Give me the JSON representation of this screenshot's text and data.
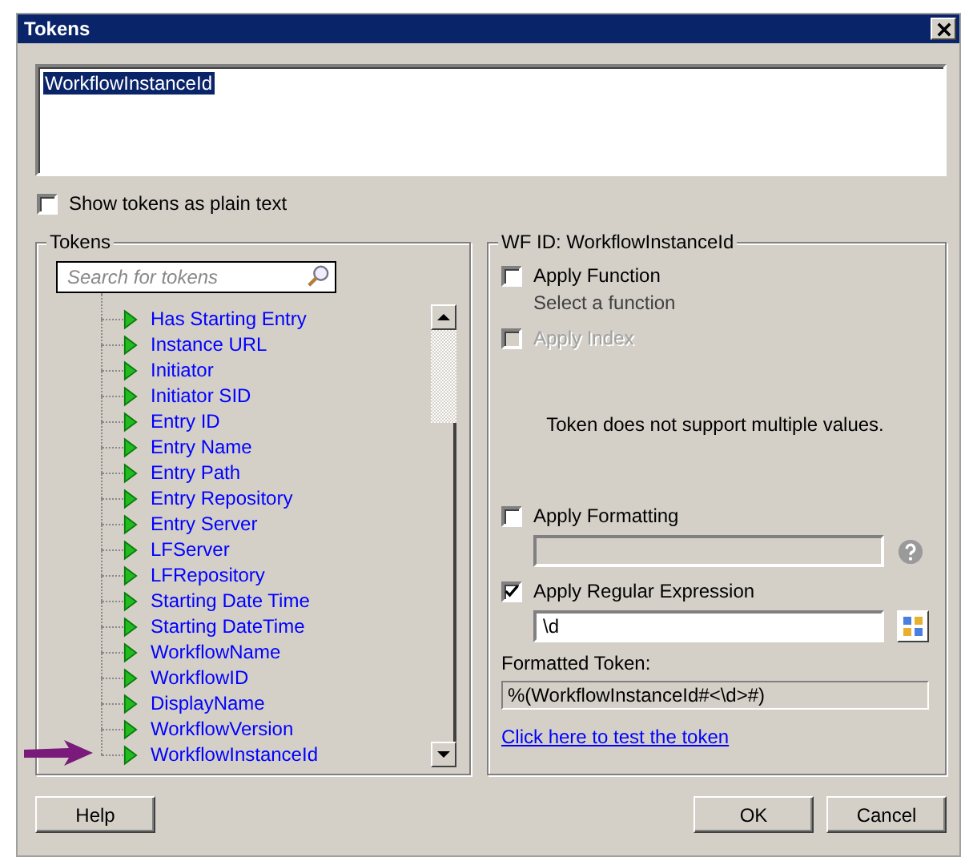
{
  "window": {
    "title": "Tokens"
  },
  "editor": {
    "text": "WorkflowInstanceId",
    "selected": true
  },
  "show_plain_text": {
    "label": "Show tokens as plain text",
    "checked": false
  },
  "tokens_panel": {
    "title": "Tokens",
    "search": {
      "placeholder": "Search for tokens"
    },
    "items": [
      {
        "label": "Has Starting Entry"
      },
      {
        "label": "Instance URL"
      },
      {
        "label": "Initiator"
      },
      {
        "label": "Initiator SID"
      },
      {
        "label": "Entry ID"
      },
      {
        "label": "Entry Name"
      },
      {
        "label": "Entry Path"
      },
      {
        "label": "Entry Repository"
      },
      {
        "label": "Entry Server"
      },
      {
        "label": "LFServer"
      },
      {
        "label": "LFRepository"
      },
      {
        "label": "Starting Date Time"
      },
      {
        "label": "Starting DateTime"
      },
      {
        "label": "WorkflowName"
      },
      {
        "label": "WorkflowID"
      },
      {
        "label": "DisplayName"
      },
      {
        "label": "WorkflowVersion"
      },
      {
        "label": "WorkflowInstanceId"
      }
    ]
  },
  "options_panel": {
    "title": "WF ID: WorkflowInstanceId",
    "apply_function": {
      "label": "Apply Function",
      "checked": false,
      "disabled": false,
      "hint": "Select a function"
    },
    "apply_index": {
      "label": "Apply Index",
      "checked": false,
      "disabled": true
    },
    "note": "Token does not support multiple values.",
    "apply_formatting": {
      "label": "Apply Formatting",
      "checked": false,
      "disabled": false
    },
    "apply_regex": {
      "label": "Apply Regular Expression",
      "checked": true,
      "disabled": false,
      "value": "\\d"
    },
    "formatted_token": {
      "label": "Formatted Token:",
      "value": "%(WorkflowInstanceId#<\\d>#)"
    },
    "test_link": "Click here to test the token"
  },
  "buttons": [
    {
      "label": "Help"
    },
    {
      "label": "OK"
    },
    {
      "label": "Cancel"
    }
  ]
}
